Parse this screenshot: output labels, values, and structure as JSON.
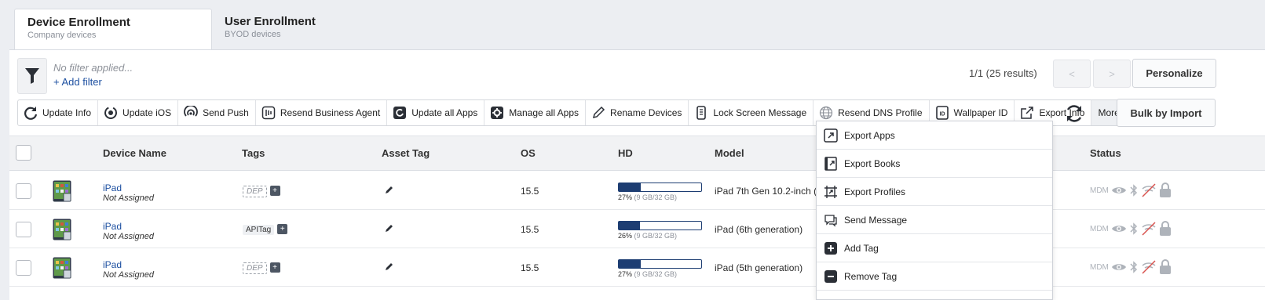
{
  "tabs": [
    {
      "title": "Device Enrollment",
      "subtitle": "Company devices"
    },
    {
      "title": "User Enrollment",
      "subtitle": "BYOD devices"
    }
  ],
  "filter": {
    "status": "No filter applied...",
    "add_label": "+ Add filter"
  },
  "pagination": {
    "results": "1/1 (25 results)",
    "prev": "<",
    "next": ">"
  },
  "personalize_label": "Personalize",
  "bulk_label": "Bulk by Import",
  "toolbar": {
    "update_info": "Update Info",
    "update_ios": "Update iOS",
    "send_push": "Send Push",
    "resend_business_agent": "Resend Business Agent",
    "update_all_apps": "Update all Apps",
    "manage_all_apps": "Manage all Apps",
    "rename_devices": "Rename Devices",
    "lock_screen_message": "Lock Screen Message",
    "resend_dns_profile": "Resend DNS Profile",
    "wallpaper_id": "Wallpaper ID",
    "export_info": "Export Info",
    "more": "More"
  },
  "columns": {
    "device_name": "Device Name",
    "tags": "Tags",
    "asset_tag": "Asset Tag",
    "os": "OS",
    "hd": "HD",
    "model": "Model",
    "status": "Status"
  },
  "rows": [
    {
      "name": "iPad",
      "assignee": "Not Assigned",
      "tag": "DEP",
      "tag_type": "dep",
      "os": "15.5",
      "hd_percent": 27,
      "hd_label": "27%",
      "hd_detail": "(9 GB/32 GB)",
      "model": "iPad 7th Gen 10.2-inch (WiFi)",
      "status_text": "MDM"
    },
    {
      "name": "iPad",
      "assignee": "Not Assigned",
      "tag": "APITag",
      "tag_type": "api",
      "os": "15.5",
      "hd_percent": 26,
      "hd_label": "26%",
      "hd_detail": "(9 GB/32 GB)",
      "model": "iPad (6th generation)",
      "status_text": "MDM"
    },
    {
      "name": "iPad",
      "assignee": "Not Assigned",
      "tag": "DEP",
      "tag_type": "dep",
      "os": "15.5",
      "hd_percent": 27,
      "hd_label": "27%",
      "hd_detail": "(9 GB/32 GB)",
      "model": "iPad (5th generation)",
      "status_text": "MDM"
    }
  ],
  "more_menu": {
    "export_apps": "Export Apps",
    "export_books": "Export Books",
    "export_profiles": "Export Profiles",
    "send_message": "Send Message",
    "add_tag": "Add Tag",
    "remove_tag": "Remove Tag"
  },
  "colors": {
    "accent": "#1c4fa0",
    "hd_bar": "#1d3d72"
  }
}
